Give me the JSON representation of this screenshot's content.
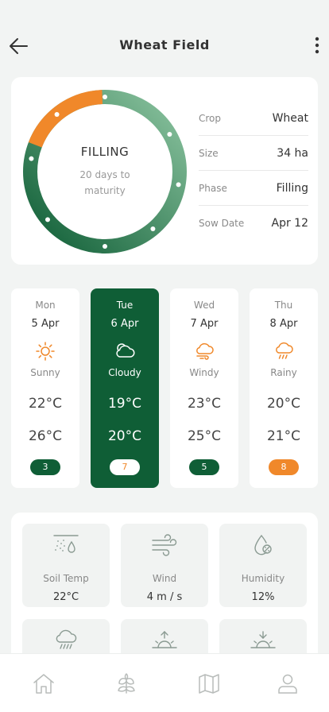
{
  "header": {
    "title": "Wheat Field"
  },
  "phase": {
    "name": "FILLING",
    "subtitle": "20 days to maturity",
    "progress": 0.12,
    "colors": {
      "progress": "#f0882a",
      "ring_start": "#0f5e36",
      "ring_end": "#8cc4a0"
    }
  },
  "info": [
    {
      "label": "Crop",
      "value": "Wheat"
    },
    {
      "label": "Size",
      "value": "34 ha"
    },
    {
      "label": "Phase",
      "value": "Filling"
    },
    {
      "label": "Sow Date",
      "value": "Apr 12"
    }
  ],
  "forecast": [
    {
      "day": "Mon",
      "date": "5 Apr",
      "condition": "Sunny",
      "icon": "sun-icon",
      "high": "22°C",
      "low": "26°C",
      "badge": "3",
      "active": false
    },
    {
      "day": "Tue",
      "date": "6 Apr",
      "condition": "Cloudy",
      "icon": "cloud-icon",
      "high": "19°C",
      "low": "20°C",
      "badge": "7",
      "active": true
    },
    {
      "day": "Wed",
      "date": "7 Apr",
      "condition": "Windy",
      "icon": "wind-cloud-icon",
      "high": "23°C",
      "low": "25°C",
      "badge": "5",
      "active": false
    },
    {
      "day": "Thu",
      "date": "8 Apr",
      "condition": "Rainy",
      "icon": "rain-cloud-icon",
      "high": "20°C",
      "low": "21°C",
      "badge": "8",
      "active": false
    }
  ],
  "metrics": [
    {
      "label": "Soil Temp",
      "value": "22°C",
      "icon": "soil-temp-icon"
    },
    {
      "label": "Wind",
      "value": "4 m / s",
      "icon": "wind-icon"
    },
    {
      "label": "Humidity",
      "value": "12%",
      "icon": "humidity-icon"
    },
    {
      "label": "",
      "value": "",
      "icon": "rain-icon"
    },
    {
      "label": "",
      "value": "",
      "icon": "sunrise-icon"
    },
    {
      "label": "",
      "value": "",
      "icon": "sunset-icon"
    }
  ],
  "nav": [
    {
      "icon": "home-icon"
    },
    {
      "icon": "plant-icon"
    },
    {
      "icon": "map-icon"
    },
    {
      "icon": "profile-icon"
    }
  ],
  "colors": {
    "primary": "#0f5e36",
    "accent": "#f0882a",
    "background": "#f2f4f3"
  }
}
